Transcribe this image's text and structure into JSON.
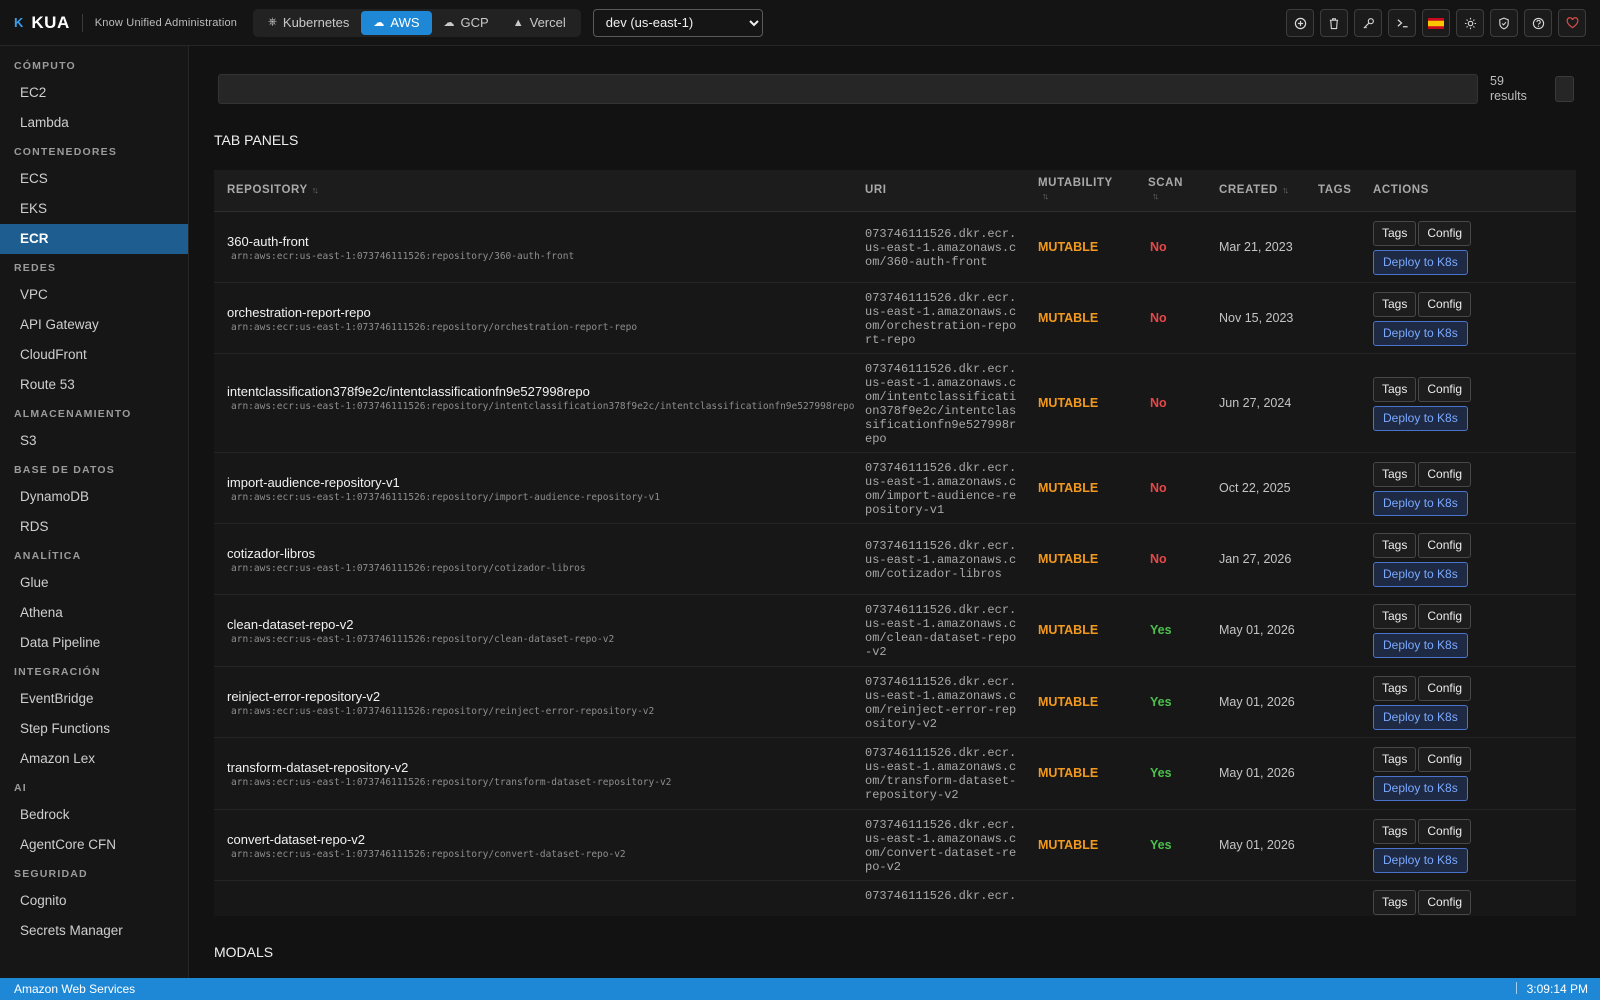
{
  "app": {
    "logo_mark": "K",
    "name": "KUA",
    "subtitle": "Know Unified Administration"
  },
  "providers": [
    {
      "label": "Kubernetes",
      "icon": "kubernetes-icon",
      "active": false
    },
    {
      "label": "AWS",
      "icon": "cloud-icon",
      "active": true
    },
    {
      "label": "GCP",
      "icon": "cloud-upload-icon",
      "active": false
    },
    {
      "label": "Vercel",
      "icon": "triangle-icon",
      "active": false
    }
  ],
  "region": {
    "selected": "dev (us-east-1)"
  },
  "toolbar": {
    "icons": [
      "plus-circle-icon",
      "trash-icon",
      "key-icon",
      "terminal-icon",
      "spain-flag-icon",
      "sun-icon",
      "shield-icon",
      "help-icon",
      "heart-icon"
    ],
    "flag": "🇪🇸"
  },
  "sidebar": {
    "sections": [
      {
        "title": "CÓMPUTO",
        "items": [
          "EC2",
          "Lambda"
        ]
      },
      {
        "title": "CONTENEDORES",
        "items": [
          "ECS",
          "EKS",
          "ECR"
        ]
      },
      {
        "title": "REDES",
        "items": [
          "VPC",
          "API Gateway",
          "CloudFront",
          "Route 53"
        ]
      },
      {
        "title": "ALMACENAMIENTO",
        "items": [
          "S3"
        ]
      },
      {
        "title": "BASE DE DATOS",
        "items": [
          "DynamoDB",
          "RDS"
        ]
      },
      {
        "title": "ANALÍTICA",
        "items": [
          "Glue",
          "Athena",
          "Data Pipeline"
        ]
      },
      {
        "title": "INTEGRACIÓN",
        "items": [
          "EventBridge",
          "Step Functions",
          "Amazon Lex"
        ]
      },
      {
        "title": "AI",
        "items": [
          "Bedrock",
          "AgentCore CFN"
        ]
      },
      {
        "title": "SEGURIDAD",
        "items": [
          "Cognito",
          "Secrets Manager"
        ]
      }
    ],
    "active": "ECR"
  },
  "search": {
    "placeholder": "",
    "results_count": "59",
    "results_label": "results"
  },
  "labels": {
    "tab_panels": "TAB PANELS",
    "modals": "MODALS"
  },
  "table": {
    "columns": {
      "repository": "REPOSITORY",
      "uri": "URI",
      "mutability": "MUTABILITY",
      "scan": "SCAN",
      "created": "CREATED",
      "tags": "TAGS",
      "actions": "ACTIONS"
    },
    "button_labels": {
      "tags": "Tags",
      "config": "Config",
      "deploy": "Deploy to K8s"
    },
    "rows": [
      {
        "name": "360-auth-front",
        "arn": "arn:aws:ecr:us-east-1:073746111526:repository/360-auth-front",
        "uri": "073746111526.dkr.ecr.us-east-1.amazonaws.com/360-auth-front",
        "mutability": "MUTABLE",
        "scan": "No",
        "created": "Mar 21, 2023"
      },
      {
        "name": "orchestration-report-repo",
        "arn": "arn:aws:ecr:us-east-1:073746111526:repository/orchestration-report-repo",
        "uri": "073746111526.dkr.ecr.us-east-1.amazonaws.com/orchestration-report-repo",
        "mutability": "MUTABLE",
        "scan": "No",
        "created": "Nov 15, 2023"
      },
      {
        "name": "intentclassification378f9e2c/intentclassificationfn9e527998repo",
        "arn": "arn:aws:ecr:us-east-1:073746111526:repository/intentclassification378f9e2c/intentclassificationfn9e527998repo",
        "uri": "073746111526.dkr.ecr.us-east-1.amazonaws.com/intentclassification378f9e2c/intentclassificationfn9e527998repo",
        "mutability": "MUTABLE",
        "scan": "No",
        "created": "Jun 27, 2024"
      },
      {
        "name": "import-audience-repository-v1",
        "arn": "arn:aws:ecr:us-east-1:073746111526:repository/import-audience-repository-v1",
        "uri": "073746111526.dkr.ecr.us-east-1.amazonaws.com/import-audience-repository-v1",
        "mutability": "MUTABLE",
        "scan": "No",
        "created": "Oct 22, 2025"
      },
      {
        "name": "cotizador-libros",
        "arn": "arn:aws:ecr:us-east-1:073746111526:repository/cotizador-libros",
        "uri": "073746111526.dkr.ecr.us-east-1.amazonaws.com/cotizador-libros",
        "mutability": "MUTABLE",
        "scan": "No",
        "created": "Jan 27, 2026"
      },
      {
        "name": "clean-dataset-repo-v2",
        "arn": "arn:aws:ecr:us-east-1:073746111526:repository/clean-dataset-repo-v2",
        "uri": "073746111526.dkr.ecr.us-east-1.amazonaws.com/clean-dataset-repo-v2",
        "mutability": "MUTABLE",
        "scan": "Yes",
        "created": "May 01, 2026"
      },
      {
        "name": "reinject-error-repository-v2",
        "arn": "arn:aws:ecr:us-east-1:073746111526:repository/reinject-error-repository-v2",
        "uri": "073746111526.dkr.ecr.us-east-1.amazonaws.com/reinject-error-repository-v2",
        "mutability": "MUTABLE",
        "scan": "Yes",
        "created": "May 01, 2026"
      },
      {
        "name": "transform-dataset-repository-v2",
        "arn": "arn:aws:ecr:us-east-1:073746111526:repository/transform-dataset-repository-v2",
        "uri": "073746111526.dkr.ecr.us-east-1.amazonaws.com/transform-dataset-repository-v2",
        "mutability": "MUTABLE",
        "scan": "Yes",
        "created": "May 01, 2026"
      },
      {
        "name": "convert-dataset-repo-v2",
        "arn": "arn:aws:ecr:us-east-1:073746111526:repository/convert-dataset-repo-v2",
        "uri": "073746111526.dkr.ecr.us-east-1.amazonaws.com/convert-dataset-repo-v2",
        "mutability": "MUTABLE",
        "scan": "Yes",
        "created": "May 01, 2026"
      }
    ],
    "partial_row": {
      "uri": "073746111526.dkr.ecr."
    }
  },
  "footer": {
    "left": "Amazon Web Services",
    "time": "3:09:14 PM"
  },
  "colors": {
    "accent": "#1e88d6",
    "mutable": "#f39a1e",
    "scan_no": "#e54848",
    "scan_yes": "#4cbf4c",
    "deploy": "#7aa8ff"
  }
}
